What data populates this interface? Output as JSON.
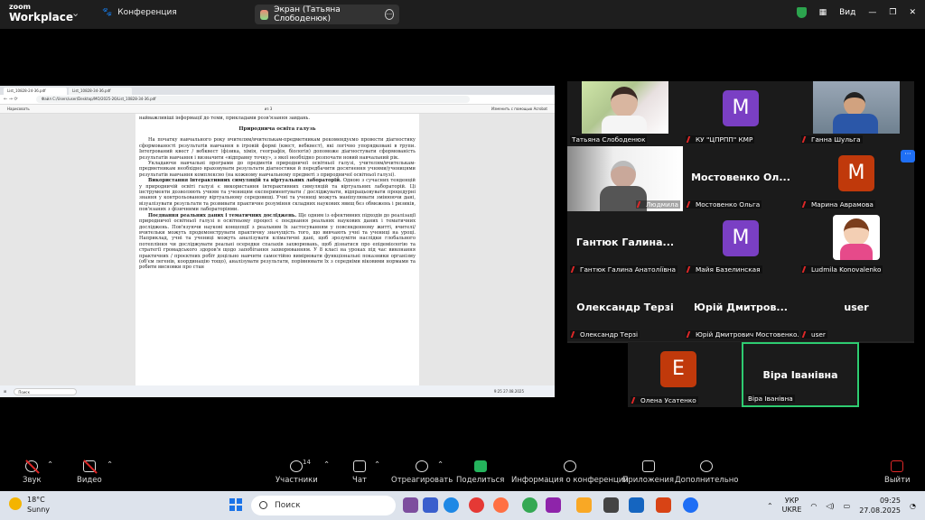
{
  "topbar": {
    "logo_line1": "zoom",
    "logo_line2": "Workplace",
    "meeting_label": "Конференция",
    "share_label": "Экран (Татьяна Слободенюк)",
    "view_label": "Вид"
  },
  "browser": {
    "tab1": "List_10828-24-36.pdf",
    "tab2": "List_10828-34-36.pdf",
    "url": "Файл  C:/Users/user/Desktop/МО/2025-26/List_10828-34-36.pdf",
    "pdf_draw": "Нарисовать",
    "pdf_page": "из 3",
    "pdf_acrobat": "Изменить с помощью Acrobat"
  },
  "pdf": {
    "p0": "найважливіші інформації до теми, прикладами розв'язання завдань.",
    "h1": "Природнича освіта галузь",
    "p1": "На початку навчального року вчителям/вчителькам-предметникам рекомендуємо провести діагностику сформованості результатів навчання в ігровій формі (квест, вебквест), які логічно упорядковані в групи. Інтегрований квест / вебквест (фізика, хімія, географія, біологія) допоможе діагностувати сформованість результатів навчання і визначити «відправну точку», з якої необхідно розпочати новий навчальний рік.",
    "p2": "Укладаючи навчальні програми до предметів природничої освітньої галузі, учителям/вчителькам-предметникам необхідно враховувати результати діагностики й передбачити досягнення учнями/ученицями результатів навчання комплексно (на кожному навчальному предметі з природничої освітньої галузі).",
    "p3b": "Використання інтерактивних симуляцій та віртуальних лабораторій.",
    "p3": " Одною з сучасних тенденцій у природничій освіті галузі є використання інтерактивних симуляцій та віртуальних лабораторій. Ці інструменти дозволяють учням та ученицям експериментувати / досліджувати, відпрацьовувати процедурні знання у контрольованому віртуальному середовищі. Учні та учениці можуть маніпулювати змінюючи дані, візуалізувати результати та розвивати практичне розуміння складних наукових явищ без обмежень і ризиків, пов'язаних з фізичними лабораторіями.",
    "p4b": "Поєднання реальних даних і тематичних досліджень.",
    "p4": " Ще одним із ефективних підходів до реалізації природничої освітньої галузі в освітньому процесі є поєднання реальних наукових даних і тематичних досліджень. Пов'язуючи наукові концепції з реальним їх застосуванням у повсякденному житті, вчителі/вчительки можуть продемонструвати практичну значущість того, що вивчають учні та учениці на уроці. Наприклад, учні та учениці можуть аналізувати кліматичні дані, щоб зрозуміти наслідки глобального потепління чи досліджувати реальні осередки спалахів захворювань, щоб дізнатися про епідеміологію та стратегії громадського здоров'я щодо запобігання захворюванням. У 8 класі на уроках під час виконання практичних / проєктних робіт доцільно навчити самостійно вимірювати функціональні показники організму (об'єм легенів, координацію тощо), аналізувати результати, порівнювати їх з середніми віковими нормами та робити висновки про стан"
  },
  "mini_taskbar": {
    "search": "Поиск",
    "clock": "9:25\n27.08.2025"
  },
  "participants": [
    {
      "name": "Татьяна Слободенюк",
      "type": "photo"
    },
    {
      "name": "КУ \"ЦПРПП\" КМР",
      "type": "avatar",
      "letter": "М",
      "color": "#7a3fc4"
    },
    {
      "name": "Ганна Шульга",
      "type": "photo"
    },
    {
      "name": "Людмила",
      "type": "photo"
    },
    {
      "name": "Мостовенко Ольга",
      "type": "text",
      "big": "Мостовенко  Ол..."
    },
    {
      "name": "Марина Аврамова",
      "type": "avatar",
      "letter": "М",
      "color": "#c0390b"
    },
    {
      "name": "Гантюк Галина Анатоліївна",
      "type": "text",
      "big": "Гантюк  Галина..."
    },
    {
      "name": "Майя Базелинская",
      "type": "avatar",
      "letter": "М",
      "color": "#7a3fc4"
    },
    {
      "name": "Ludmila Konovalenko",
      "type": "cartoon"
    },
    {
      "name": "Олександр Терзі",
      "type": "text",
      "big": "Олександр Терзі"
    },
    {
      "name": "Юрій Дмитрович Мостовенко...",
      "type": "text",
      "big": "Юрій  Дмитров..."
    },
    {
      "name": "user",
      "type": "text",
      "big": "user"
    },
    {
      "name": "Олена Усатенко",
      "type": "avatar",
      "letter": "Е",
      "color": "#c0390b"
    },
    {
      "name": "Віра Іванівна",
      "type": "text",
      "big": "Віра Іванівна"
    }
  ],
  "toolbar": {
    "audio": "Звук",
    "video": "Видео",
    "participants": "Участники",
    "participants_count": "14",
    "chat": "Чат",
    "react": "Отреагировать",
    "share": "Поделиться",
    "info": "Информация о конференции",
    "apps": "Приложения",
    "more": "Дополнительно",
    "leave": "Выйти"
  },
  "taskbar": {
    "temp": "18°C",
    "weather": "Sunny",
    "search": "Поиск",
    "lang1": "УКР",
    "lang2": "UKRE",
    "time": "09:25",
    "date": "27.08.2025"
  }
}
